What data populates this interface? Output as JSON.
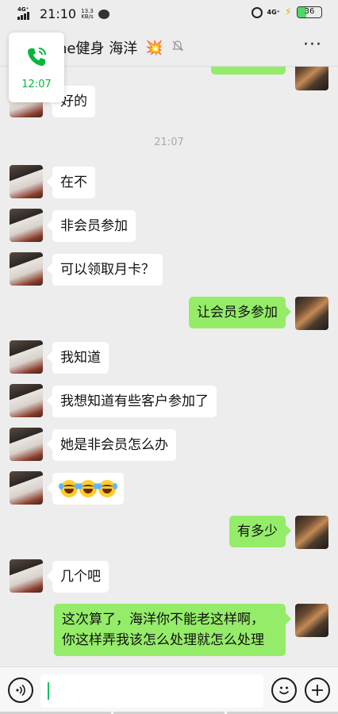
{
  "status_bar": {
    "network_left": "4G⁺",
    "time": "21:10",
    "speed_value": "13.3",
    "speed_unit": "KB/s",
    "network_right": "4G⁺",
    "battery": "36",
    "battery_level": 0.36
  },
  "header": {
    "title": "one健身 海洋",
    "title_emoji": "💥",
    "more": "···"
  },
  "call_float": {
    "duration": "12:07"
  },
  "messages": [
    {
      "side": "left",
      "text": "好的"
    },
    {
      "type": "timestamp",
      "text": "21:07"
    },
    {
      "side": "left",
      "text": "在不"
    },
    {
      "side": "left",
      "text": "非会员参加"
    },
    {
      "side": "left",
      "text": "可以领取月卡？"
    },
    {
      "side": "right",
      "text": "让会员多参加"
    },
    {
      "side": "left",
      "text": "我知道"
    },
    {
      "side": "left",
      "text": "我想知道有些客户参加了"
    },
    {
      "side": "left",
      "text": "她是非会员怎么办"
    },
    {
      "side": "left",
      "emoji": "laughing-crying x3"
    },
    {
      "side": "right",
      "text": "有多少"
    },
    {
      "side": "left",
      "text": "几个吧"
    },
    {
      "side": "right",
      "lines": [
        "这次算了，海洋你不能老这样啊，",
        "你这样弄我该怎么处理就怎么处理"
      ]
    }
  ],
  "input_bar": {
    "value": ""
  },
  "colors": {
    "sent_bubble": "#95ec69",
    "received_bubble": "#ffffff",
    "accent_green": "#07c160",
    "background": "#ededed"
  }
}
